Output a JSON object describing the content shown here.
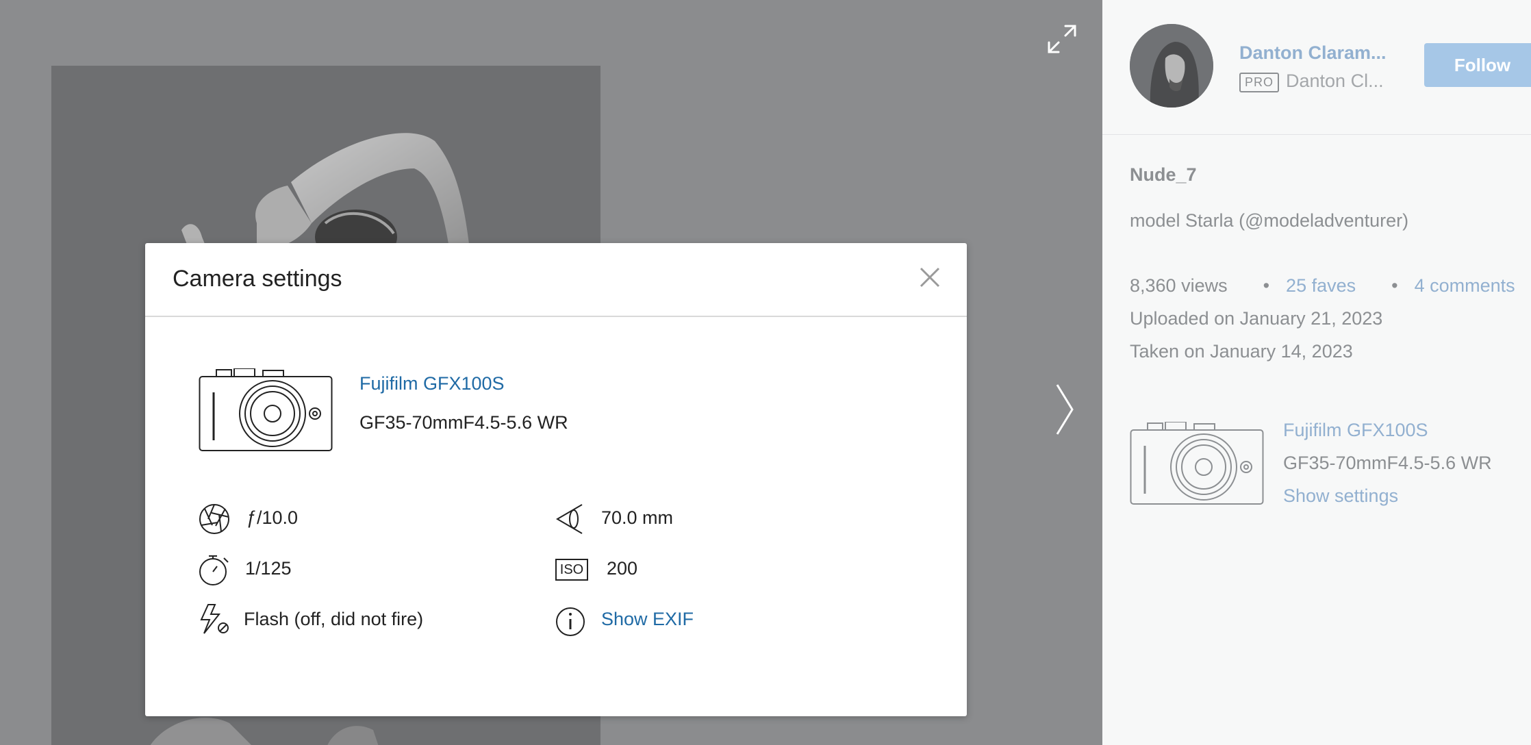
{
  "modal": {
    "title": "Camera settings",
    "camera_name": "Fujifilm GFX100S",
    "lens": "GF35-70mmF4.5-5.6 WR",
    "aperture": "ƒ/10.0",
    "focal_length": "70.0 mm",
    "shutter_speed": "1/125",
    "iso_label": "ISO",
    "iso": "200",
    "flash": "Flash (off, did not fire)",
    "show_exif": "Show EXIF"
  },
  "sidebar": {
    "author_name": "Danton Claram...",
    "pro_badge": "PRO",
    "author_handle": "Danton Cl...",
    "follow_label": "Follow",
    "photo_title": "Nude_7",
    "description": "model Starla (@modeladventurer)",
    "views": "8,360 views",
    "faves": "25 faves",
    "comments": "4 comments",
    "uploaded": "Uploaded on January 21, 2023",
    "taken": "Taken on January 14, 2023",
    "camera_name": "Fujifilm GFX100S",
    "lens": "GF35-70mmF4.5-5.6 WR",
    "show_settings": "Show settings"
  },
  "icons": [
    "expand-icon",
    "chevron-right-icon",
    "close-icon",
    "camera-icon",
    "aperture-icon",
    "focal-length-icon",
    "timer-icon",
    "iso-icon",
    "flash-off-icon",
    "info-icon"
  ],
  "colors": {
    "link": "#1f6aa5",
    "sidebar_link": "#92b0d0",
    "follow_button": "#a6c7e7",
    "overlay": "#8b8c8e"
  }
}
